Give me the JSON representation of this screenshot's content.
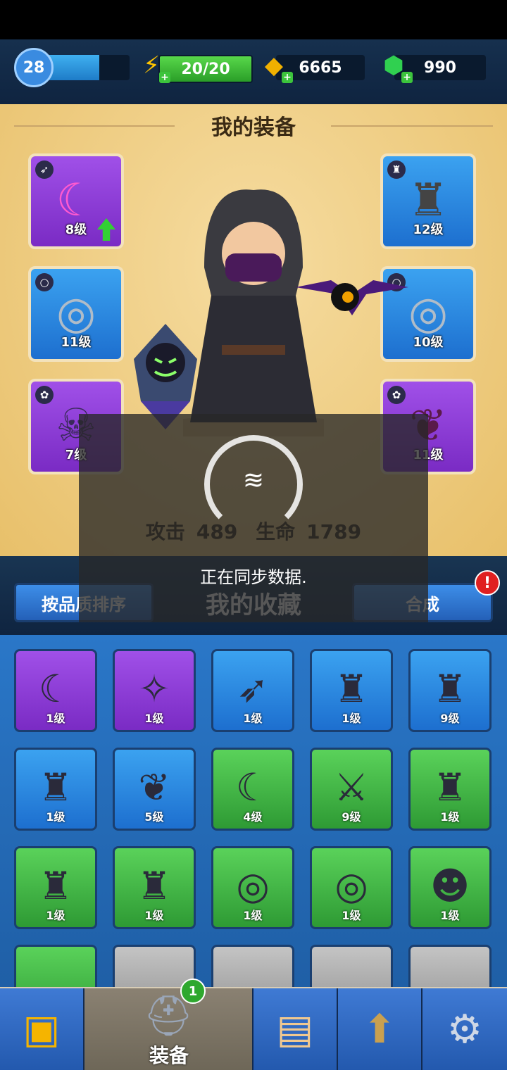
{
  "hud": {
    "level": "28",
    "xp_fraction": 0.65,
    "energy": "20/20",
    "gold": "6665",
    "gems": "990"
  },
  "equipment": {
    "title": "我的装备",
    "slots": [
      {
        "level": "8级",
        "icon": "crossbow-icon",
        "quality": "purple",
        "upgrade": true
      },
      {
        "level": "12级",
        "icon": "armor-icon",
        "quality": "blue"
      },
      {
        "level": "11级",
        "icon": "ring-icon",
        "quality": "blue"
      },
      {
        "level": "10级",
        "icon": "ring-icon",
        "quality": "blue"
      },
      {
        "level": "7级",
        "icon": "pet-icon",
        "quality": "purple"
      },
      {
        "level": "11级",
        "icon": "pet-icon",
        "quality": "purple"
      }
    ],
    "stats": {
      "attack_label": "攻击",
      "attack": "489",
      "hp_label": "生命",
      "hp": "1789"
    }
  },
  "loading": {
    "text": "正在同步数据."
  },
  "collection": {
    "title": "我的收藏",
    "sort_label": "按品质排序",
    "merge_label": "合成",
    "alert": "!",
    "items": [
      {
        "level": "1级",
        "quality": "purple"
      },
      {
        "level": "1级",
        "quality": "purple"
      },
      {
        "level": "1级",
        "quality": "blue"
      },
      {
        "level": "1级",
        "quality": "blue"
      },
      {
        "level": "9级",
        "quality": "blue"
      },
      {
        "level": "1级",
        "quality": "blue"
      },
      {
        "level": "5级",
        "quality": "blue"
      },
      {
        "level": "4级",
        "quality": "green"
      },
      {
        "level": "9级",
        "quality": "green"
      },
      {
        "level": "1级",
        "quality": "green"
      },
      {
        "level": "1级",
        "quality": "green"
      },
      {
        "level": "1级",
        "quality": "green"
      },
      {
        "level": "1级",
        "quality": "green"
      },
      {
        "level": "1级",
        "quality": "green"
      },
      {
        "level": "1级",
        "quality": "green"
      }
    ]
  },
  "tabs": {
    "equipment_label": "装备",
    "equipment_badge": "1"
  }
}
